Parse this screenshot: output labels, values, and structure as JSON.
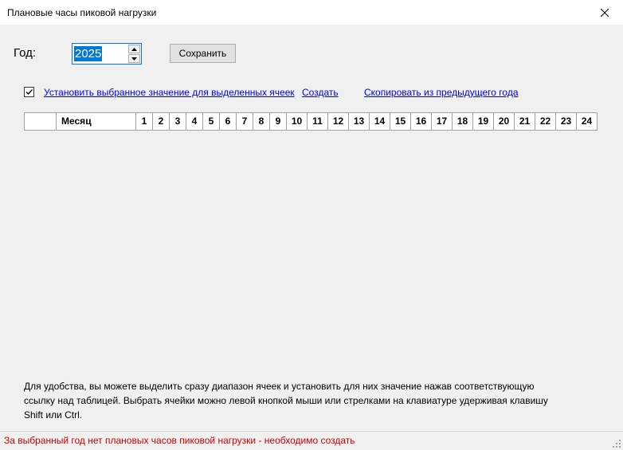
{
  "window": {
    "title": "Плановые часы пиковой нагрузки"
  },
  "year": {
    "label": "Год:",
    "value": "2025"
  },
  "toolbar": {
    "save_label": "Сохранить"
  },
  "options": {
    "apply_checked": true,
    "apply_link": "Установить выбранное значение для выделенных ячеек",
    "create_link": "Создать",
    "copy_link": "Скопировать из предыдущего года"
  },
  "grid": {
    "month_header": "Месяц",
    "hour_headers": [
      "1",
      "2",
      "3",
      "4",
      "5",
      "6",
      "7",
      "8",
      "9",
      "10",
      "11",
      "12",
      "13",
      "14",
      "15",
      "16",
      "17",
      "18",
      "19",
      "20",
      "21",
      "22",
      "23",
      "24"
    ]
  },
  "hint": {
    "line1": "Для удобства, вы можете выделить сразу диапазон ячеек и установить для них значение нажав соответствующую",
    "line2": "ссылку над таблицей. Выбрать ячейки можно левой кнопкой мыши или стрелками на клавиатуре удерживая клавишу",
    "line3": "Shift или Ctrl."
  },
  "status": {
    "text": "За выбранный год нет плановых часов пиковой нагрузки - необходимо создать",
    "color": "#cc0000"
  },
  "colors": {
    "accent": "#0078d7",
    "link": "#0000ee"
  }
}
